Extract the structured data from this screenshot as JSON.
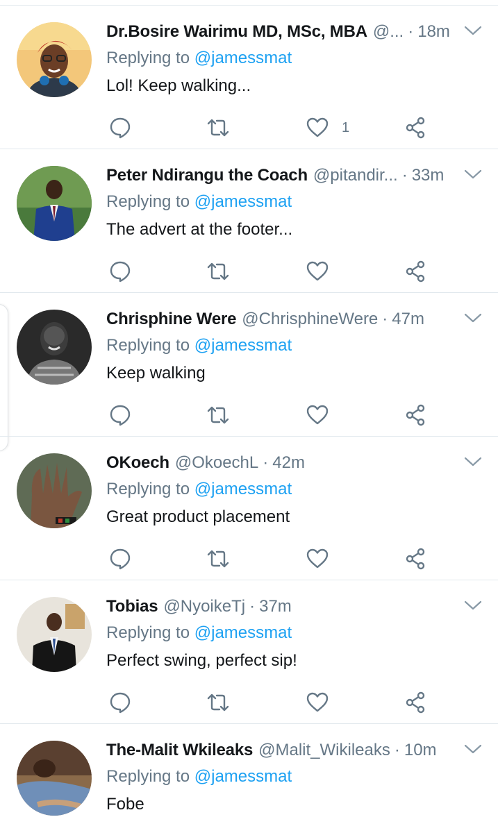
{
  "colors": {
    "accent": "#1da1f2",
    "secondary_text": "#657786",
    "primary_text": "#14171a",
    "divider": "#e1e8ed"
  },
  "icons": {
    "reply": "reply-bubble-icon",
    "retweet": "retweet-icon",
    "like": "heart-icon",
    "share": "share-icon",
    "menu": "chevron-down-icon"
  },
  "tweets": [
    {
      "name": "Dr.Bosire Wairimu MD, MSc, MBA",
      "handle": "@...",
      "time": "18m",
      "replying_prefix": "Replying to",
      "replying_to": "@jamessmat",
      "text": "Lol! Keep walking...",
      "like_count": "1"
    },
    {
      "name": "Peter Ndirangu the Coach",
      "handle": "@pitandir...",
      "time": "33m",
      "replying_prefix": "Replying to",
      "replying_to": "@jamessmat",
      "text": "The advert at the footer...",
      "like_count": ""
    },
    {
      "name": "Chrisphine Were",
      "handle": "@ChrisphineWere",
      "time": "47m",
      "replying_prefix": "Replying to",
      "replying_to": "@jamessmat",
      "text": "Keep walking",
      "like_count": ""
    },
    {
      "name": "OKoech",
      "handle": "@OkoechL",
      "time": "42m",
      "replying_prefix": "Replying to",
      "replying_to": "@jamessmat",
      "text": "Great product placement",
      "like_count": ""
    },
    {
      "name": "Tobias",
      "handle": "@NyoikeTj",
      "time": "37m",
      "replying_prefix": "Replying to",
      "replying_to": "@jamessmat",
      "text": "Perfect swing, perfect sip!",
      "like_count": ""
    },
    {
      "name": "The-Malit Wkileaks",
      "handle": "@Malit_Wikileaks",
      "time": "10m",
      "replying_prefix": "Replying to",
      "replying_to": "@jamessmat",
      "text": "Fobe",
      "like_count": ""
    }
  ]
}
